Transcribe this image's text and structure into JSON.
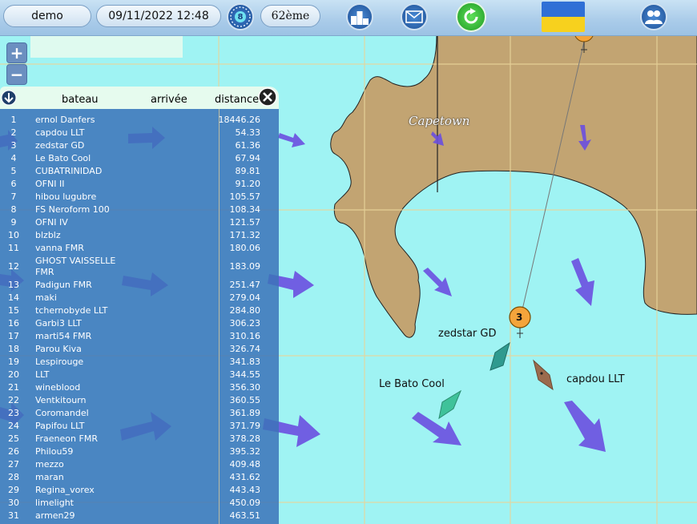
{
  "header": {
    "user": "demo",
    "datetime": "09/11/2022 12:48",
    "clock_badge": "8",
    "rank": "62ème",
    "ranking_icon_digits": "213"
  },
  "map": {
    "city_label": "Capetown",
    "marker_number": "3",
    "boats": [
      {
        "name": "zedstar GD"
      },
      {
        "name": "Le Bato Cool"
      },
      {
        "name": "capdou LLT"
      }
    ],
    "colors": {
      "sea": "#9ff3f3",
      "land": "#c2a472",
      "grid": "#e8d49a",
      "arrow": "#6a4fe0",
      "boat_teal": "#2f9a8f",
      "boat_brown": "#9b6b4d"
    }
  },
  "zoom": {
    "in": "+",
    "out": "−"
  },
  "list": {
    "headers": {
      "boat": "bateau",
      "arrival": "arrivée",
      "distance": "distance"
    },
    "rows": [
      {
        "rank": "1",
        "name": "ernol Danfers",
        "distance": "18446.26"
      },
      {
        "rank": "2",
        "name": "capdou LLT",
        "distance": "54.33"
      },
      {
        "rank": "3",
        "name": "zedstar GD",
        "distance": "61.36"
      },
      {
        "rank": "4",
        "name": "Le Bato Cool",
        "distance": "67.94"
      },
      {
        "rank": "5",
        "name": "CUBATRINIDAD",
        "distance": "89.81"
      },
      {
        "rank": "6",
        "name": "OFNI II",
        "distance": "91.20"
      },
      {
        "rank": "7",
        "name": "hibou lugubre",
        "distance": "105.57"
      },
      {
        "rank": "8",
        "name": "FS Neroform 100",
        "distance": "108.34"
      },
      {
        "rank": "9",
        "name": "OFNI IV",
        "distance": "121.57"
      },
      {
        "rank": "10",
        "name": "blzblz",
        "distance": "171.32"
      },
      {
        "rank": "11",
        "name": "vanna FMR",
        "distance": "180.06"
      },
      {
        "rank": "12",
        "name": "GHOST VAISSELLE FMR",
        "distance": "183.09"
      },
      {
        "rank": "13",
        "name": "Padigun FMR",
        "distance": "251.47"
      },
      {
        "rank": "14",
        "name": "maki",
        "distance": "279.04"
      },
      {
        "rank": "15",
        "name": "tchernobyde LLT",
        "distance": "284.80"
      },
      {
        "rank": "16",
        "name": "Garbi3 LLT",
        "distance": "306.23"
      },
      {
        "rank": "17",
        "name": "marti54 FMR",
        "distance": "310.16"
      },
      {
        "rank": "18",
        "name": "Parou Kiva",
        "distance": "326.74"
      },
      {
        "rank": "19",
        "name": "Lespirouge",
        "distance": "341.83"
      },
      {
        "rank": "20",
        "name": "LLT",
        "distance": "344.55"
      },
      {
        "rank": "21",
        "name": "wineblood",
        "distance": "356.30"
      },
      {
        "rank": "22",
        "name": "Ventkitourn",
        "distance": "360.55"
      },
      {
        "rank": "23",
        "name": "Coromandel",
        "distance": "361.89"
      },
      {
        "rank": "24",
        "name": "Papifou LLT",
        "distance": "371.79"
      },
      {
        "rank": "25",
        "name": "Fraeneon FMR",
        "distance": "378.28"
      },
      {
        "rank": "26",
        "name": "Philou59",
        "distance": "395.32"
      },
      {
        "rank": "27",
        "name": "mezzo",
        "distance": "409.48"
      },
      {
        "rank": "28",
        "name": "maran",
        "distance": "431.62"
      },
      {
        "rank": "29",
        "name": "Regina_vorex",
        "distance": "443.43"
      },
      {
        "rank": "30",
        "name": "limelight",
        "distance": "450.09"
      },
      {
        "rank": "31",
        "name": "armen29",
        "distance": "463.51"
      }
    ]
  }
}
